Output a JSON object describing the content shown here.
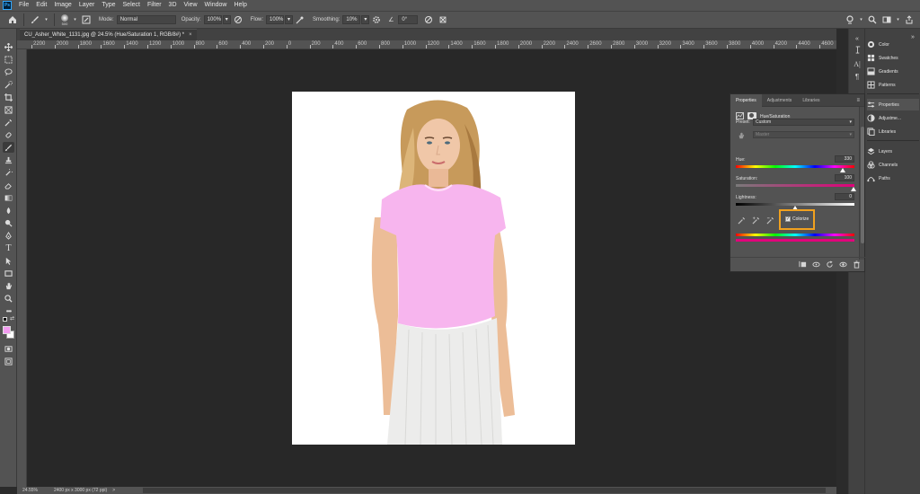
{
  "menubar": {
    "logo": "Ps",
    "items": [
      "File",
      "Edit",
      "Image",
      "Layer",
      "Type",
      "Select",
      "Filter",
      "3D",
      "View",
      "Window",
      "Help"
    ]
  },
  "options": {
    "brush_size": "500",
    "mode_label": "Mode:",
    "mode_value": "Normal",
    "opacity_label": "Opacity:",
    "opacity_value": "100%",
    "flow_label": "Flow:",
    "flow_value": "100%",
    "smoothing_label": "Smoothing:",
    "smoothing_value": "10%",
    "angle_value": "0°"
  },
  "document_tab": {
    "title": "CU_Asher_White_1131.jpg @ 24.5% (Hue/Saturation 1, RGB/8#) *",
    "close": "×"
  },
  "ruler": {
    "labels": [
      "2200",
      "2000",
      "1800",
      "1600",
      "1400",
      "1200",
      "1000",
      "800",
      "600",
      "400",
      "200",
      "0",
      "200",
      "400",
      "600",
      "800",
      "1000",
      "1200",
      "1400",
      "1600",
      "1800",
      "2000",
      "2200",
      "2400",
      "2600",
      "2800",
      "3000",
      "3200",
      "3400",
      "3600",
      "3800",
      "4000",
      "4200",
      "4400",
      "4600"
    ]
  },
  "statusbar": {
    "zoom": "24.55%",
    "doc_info": "2400 px x 3000 px (72 ppi)",
    "arrow": ">"
  },
  "properties_panel": {
    "tabs": [
      "Properties",
      "Adjustments",
      "Libraries"
    ],
    "active_tab": "Properties",
    "menu_glyph": "≡",
    "adjustment_title": "Hue/Saturation",
    "preset_label": "Preset:",
    "preset_value": "Custom",
    "channel_value": "Master",
    "hue_label": "Hue:",
    "hue_value": "330",
    "saturation_label": "Saturation:",
    "saturation_value": "100",
    "lightness_label": "Lightness:",
    "lightness_value": "0",
    "colorize_label": "Colorize",
    "colorize_checked": true
  },
  "dock": {
    "items": [
      {
        "label": "Color",
        "icon": "color-wheel-icon"
      },
      {
        "label": "Swatches",
        "icon": "swatches-grid-icon"
      },
      {
        "label": "Gradients",
        "icon": "gradient-icon"
      },
      {
        "label": "Patterns",
        "icon": "patterns-icon"
      },
      {
        "label": "Properties",
        "icon": "properties-sliders-icon"
      },
      {
        "label": "Adjustme...",
        "icon": "adjustments-circle-icon"
      },
      {
        "label": "Libraries",
        "icon": "libraries-icon"
      },
      {
        "label": "Layers",
        "icon": "layers-icon"
      },
      {
        "label": "Channels",
        "icon": "channels-icon"
      },
      {
        "label": "Paths",
        "icon": "paths-icon"
      }
    ]
  },
  "colors": {
    "foreground": "#f29bf0",
    "background": "#ffffff",
    "highlight": "#f1a11f"
  }
}
